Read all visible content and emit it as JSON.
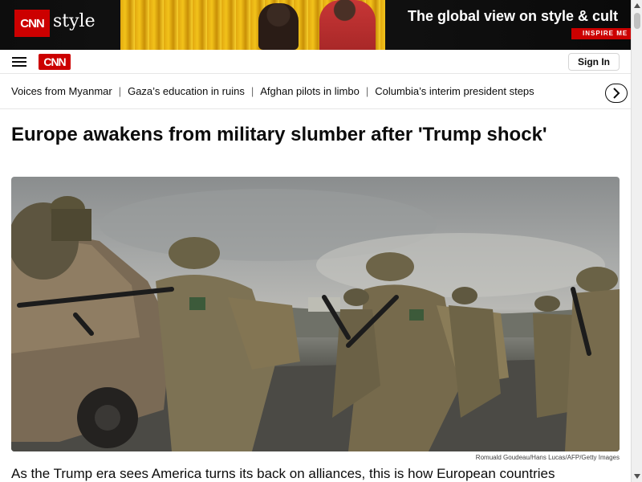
{
  "ad": {
    "logo": "CNN",
    "style_word": "style",
    "headline": "The global view on style & cult",
    "cta": "INSPIRE ME"
  },
  "header": {
    "logo": "CNN",
    "signin_label": "Sign In"
  },
  "trending": {
    "items": [
      "Voices from Myanmar",
      "Gaza’s education in ruins",
      "Afghan pilots in limbo",
      "Columbia’s interim president steps"
    ],
    "separator": "|"
  },
  "article": {
    "headline": "Europe awakens from military slumber after 'Trump shock'",
    "image_credit": "Romuald Goudeau/Hans Lucas/AFP/Getty Images",
    "subhead": "As the Trump era sees America turns its back on alliances, this is how European countries"
  },
  "icons": {
    "menu": "hamburger-icon",
    "next": "chevron-right-icon",
    "scroll_up": "arrow-up-icon",
    "scroll_down": "arrow-down-icon"
  },
  "colors": {
    "brand_red": "#cc0000",
    "text": "#0c0c0c",
    "ad_yellow": "#f2c21a"
  }
}
